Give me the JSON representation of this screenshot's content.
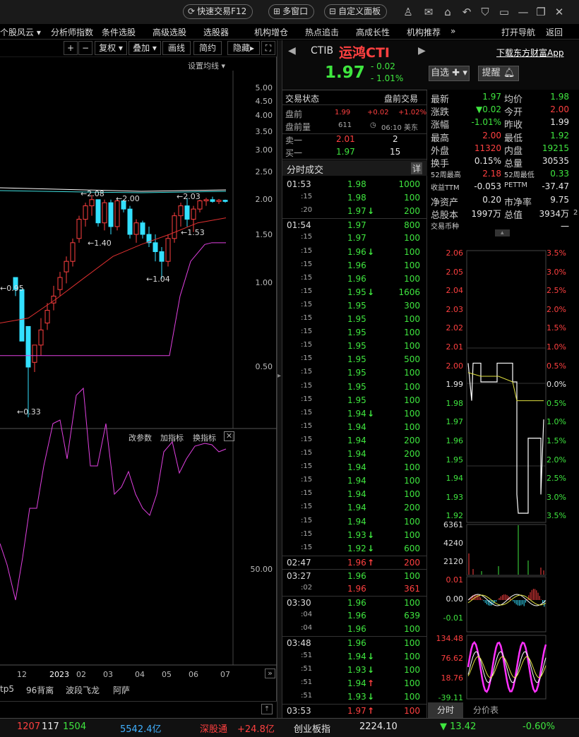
{
  "topbar": {
    "quick_trade": "快速交易F12",
    "multi_window": "多窗口",
    "custom_panel": "自定义面板"
  },
  "menu": [
    "个股风云",
    "分析师指数",
    "条件选股",
    "高级选股",
    "选股器",
    "机构增仓",
    "热点追击",
    "高成长性",
    "机构推荐",
    "打开导航",
    "返回"
  ],
  "chart_toolbar": {
    "fuquan": "复权",
    "diejia": "叠加",
    "huaxian": "画线",
    "jianyue": "简约",
    "yincang": "隐藏",
    "set_ma": "设置均线"
  },
  "price_axis": [
    "5.00",
    "4.50",
    "4.00",
    "3.50",
    "3.00",
    "2.50",
    "2.00",
    "1.50",
    "1.00",
    "0.50"
  ],
  "chart_annotations": [
    "2.08",
    "2.00",
    "2.03",
    "1.40",
    "1.53",
    "1.04",
    "0.95",
    "0.33"
  ],
  "indicator_bar": {
    "param": "改参数",
    "add": "加指标",
    "switch": "换指标"
  },
  "indicator_axis": "50.00",
  "time_axis": [
    "12",
    "2023",
    "02",
    "03",
    "04",
    "05",
    "06",
    "07"
  ],
  "indicator_tabs": [
    "tp5",
    "96背离",
    "波段飞龙",
    "阿萨"
  ],
  "quote": {
    "code": "CTIB",
    "name": "运鸿CTI",
    "price": "1.97",
    "change": "- 0.02",
    "change_pct": "- 1.01%",
    "watch_btn": "自选",
    "alert_btn": "提醒",
    "download": "下载东方财富App"
  },
  "trade_status": {
    "label": "交易状态",
    "value": "盘前交易",
    "premarket_label": "盘前",
    "premarket_price": "1.99",
    "premarket_chg": "+0.02",
    "premarket_pct": "+1.02%",
    "premarket_vol_label": "盘前量",
    "premarket_vol": "611",
    "time": "06:10 美东",
    "sell1_label": "卖一",
    "sell1_price": "2.01",
    "sell1_vol": "2",
    "buy1_label": "买一",
    "buy1_price": "1.97",
    "buy1_vol": "15"
  },
  "ticks_header": {
    "title": "分时成交",
    "detail": "详"
  },
  "ticks": [
    {
      "t": "01:53",
      "p": "1.98",
      "v": "1000",
      "c": "g",
      "d": ""
    },
    {
      "t": ":15",
      "p": "1.98",
      "v": "100",
      "c": "g",
      "d": ""
    },
    {
      "t": ":20",
      "p": "1.97",
      "v": "200",
      "c": "g",
      "d": "down"
    },
    {
      "t": "01:54",
      "p": "1.97",
      "v": "800",
      "c": "g",
      "d": ""
    },
    {
      "t": ":15",
      "p": "1.97",
      "v": "100",
      "c": "g",
      "d": ""
    },
    {
      "t": ":15",
      "p": "1.96",
      "v": "100",
      "c": "g",
      "d": "down"
    },
    {
      "t": ":15",
      "p": "1.96",
      "v": "100",
      "c": "g",
      "d": ""
    },
    {
      "t": ":15",
      "p": "1.96",
      "v": "100",
      "c": "g",
      "d": ""
    },
    {
      "t": ":15",
      "p": "1.95",
      "v": "1606",
      "c": "g",
      "d": "down"
    },
    {
      "t": ":15",
      "p": "1.95",
      "v": "300",
      "c": "g",
      "d": ""
    },
    {
      "t": ":15",
      "p": "1.95",
      "v": "100",
      "c": "g",
      "d": ""
    },
    {
      "t": ":15",
      "p": "1.95",
      "v": "100",
      "c": "g",
      "d": ""
    },
    {
      "t": ":15",
      "p": "1.95",
      "v": "100",
      "c": "g",
      "d": ""
    },
    {
      "t": ":15",
      "p": "1.95",
      "v": "500",
      "c": "g",
      "d": ""
    },
    {
      "t": ":15",
      "p": "1.95",
      "v": "100",
      "c": "g",
      "d": ""
    },
    {
      "t": ":15",
      "p": "1.95",
      "v": "100",
      "c": "g",
      "d": ""
    },
    {
      "t": ":15",
      "p": "1.95",
      "v": "100",
      "c": "g",
      "d": ""
    },
    {
      "t": ":15",
      "p": "1.94",
      "v": "100",
      "c": "g",
      "d": "down"
    },
    {
      "t": ":15",
      "p": "1.94",
      "v": "100",
      "c": "g",
      "d": ""
    },
    {
      "t": ":15",
      "p": "1.94",
      "v": "200",
      "c": "g",
      "d": ""
    },
    {
      "t": ":15",
      "p": "1.94",
      "v": "200",
      "c": "g",
      "d": ""
    },
    {
      "t": ":15",
      "p": "1.94",
      "v": "100",
      "c": "g",
      "d": ""
    },
    {
      "t": ":15",
      "p": "1.94",
      "v": "100",
      "c": "g",
      "d": ""
    },
    {
      "t": ":15",
      "p": "1.94",
      "v": "100",
      "c": "g",
      "d": ""
    },
    {
      "t": ":15",
      "p": "1.94",
      "v": "200",
      "c": "g",
      "d": ""
    },
    {
      "t": ":15",
      "p": "1.94",
      "v": "100",
      "c": "g",
      "d": ""
    },
    {
      "t": ":15",
      "p": "1.93",
      "v": "100",
      "c": "g",
      "d": "down"
    },
    {
      "t": ":15",
      "p": "1.92",
      "v": "600",
      "c": "g",
      "d": "down"
    },
    {
      "t": "02:47",
      "p": "1.96",
      "v": "200",
      "c": "r",
      "d": "up"
    },
    {
      "t": "03:27",
      "p": "1.96",
      "v": "100",
      "c": "g",
      "d": ""
    },
    {
      "t": ":02",
      "p": "1.96",
      "v": "361",
      "c": "r",
      "d": ""
    },
    {
      "t": "03:30",
      "p": "1.96",
      "v": "100",
      "c": "g",
      "d": ""
    },
    {
      "t": ":04",
      "p": "1.96",
      "v": "639",
      "c": "g",
      "d": ""
    },
    {
      "t": ":04",
      "p": "1.96",
      "v": "100",
      "c": "g",
      "d": ""
    },
    {
      "t": "03:48",
      "p": "1.96",
      "v": "100",
      "c": "g",
      "d": ""
    },
    {
      "t": ":51",
      "p": "1.94",
      "v": "100",
      "c": "g",
      "d": "down"
    },
    {
      "t": ":51",
      "p": "1.93",
      "v": "100",
      "c": "g",
      "d": "down"
    },
    {
      "t": ":51",
      "p": "1.94",
      "v": "100",
      "c": "g",
      "d": "up"
    },
    {
      "t": ":51",
      "p": "1.93",
      "v": "100",
      "c": "g",
      "d": "down"
    },
    {
      "t": "03:53",
      "p": "1.97",
      "v": "100",
      "c": "r",
      "d": "up"
    }
  ],
  "stats": [
    {
      "l1": "最新",
      "v1": "1.97",
      "c1": "g",
      "l2": "均价",
      "v2": "1.98",
      "c2": "g"
    },
    {
      "l1": "涨跌",
      "v1": "▼0.02",
      "c1": "g",
      "l2": "今开",
      "v2": "2.00",
      "c2": "r"
    },
    {
      "l1": "涨幅",
      "v1": "-1.01%",
      "c1": "g",
      "l2": "昨收",
      "v2": "1.99",
      "c2": "w"
    },
    {
      "l1": "最高",
      "v1": "2.00",
      "c1": "r",
      "l2": "最低",
      "v2": "1.92",
      "c2": "g"
    },
    {
      "l1": "外盘",
      "v1": "11320",
      "c1": "r",
      "l2": "内盘",
      "v2": "19215",
      "c2": "g"
    },
    {
      "l1": "换手",
      "v1": "0.15%",
      "c1": "w",
      "l2": "总量",
      "v2": "30535",
      "c2": "w"
    },
    {
      "l1": "52周最高",
      "v1": "2.18",
      "c1": "r",
      "l2": "52周最低",
      "v2": "0.33",
      "c2": "g"
    },
    {
      "l1": "收益TTM",
      "v1": "-0.053",
      "c1": "w",
      "l2": "PETTM",
      "v2": "-37.47",
      "c2": "w"
    },
    {
      "l1": "净资产",
      "v1": "0.20",
      "c1": "w",
      "l2": "市净率",
      "v2": "9.75",
      "c2": "w"
    },
    {
      "l1": "总股本",
      "v1": "1997万",
      "c1": "w",
      "l2": "总值",
      "v2": "3934万",
      "c2": "w"
    },
    {
      "l1": "交易币种",
      "v1": "",
      "c1": "w",
      "l2": "",
      "v2": "一",
      "c2": "w"
    }
  ],
  "mini_left_axis": [
    "2.06",
    "2.05",
    "2.04",
    "2.03",
    "2.02",
    "2.01",
    "2.00",
    "1.99",
    "1.98",
    "1.97",
    "1.96",
    "1.95",
    "1.94",
    "1.93",
    "1.92"
  ],
  "mini_right_axis": [
    "3.5%",
    "3.0%",
    "2.5%",
    "2.0%",
    "1.5%",
    "1.0%",
    "0.5%",
    "0.0%",
    "0.5%",
    "1.0%",
    "1.5%",
    "2.0%",
    "2.5%",
    "3.0%",
    "3.5%"
  ],
  "vol_axis": [
    "6361",
    "4240",
    "2120"
  ],
  "macd_axis": [
    "0.01",
    "0.00",
    "-0.01"
  ],
  "kdj_axis": [
    "134.48",
    "76.62",
    "18.76",
    "-39.11"
  ],
  "bottom_tabs": [
    "分时",
    "分价表"
  ],
  "statusbar": {
    "up": "1207",
    "flat": "117",
    "down": "1504",
    "amount": "5542.4亿",
    "szt_label": "深股通",
    "szt_value": "+24.8亿",
    "cyb_label": "创业板指",
    "cyb_value": "2224.10",
    "cyb_chg": "▼ 13.42",
    "cyb_pct": "-0.60%"
  },
  "colors": {
    "up": "#ff4040",
    "down": "#3fe63f",
    "candle_up": "#ff4040",
    "candle_down": "#33e0ff",
    "ma_magenta": "#e040e0",
    "ma_red": "#e03030"
  }
}
